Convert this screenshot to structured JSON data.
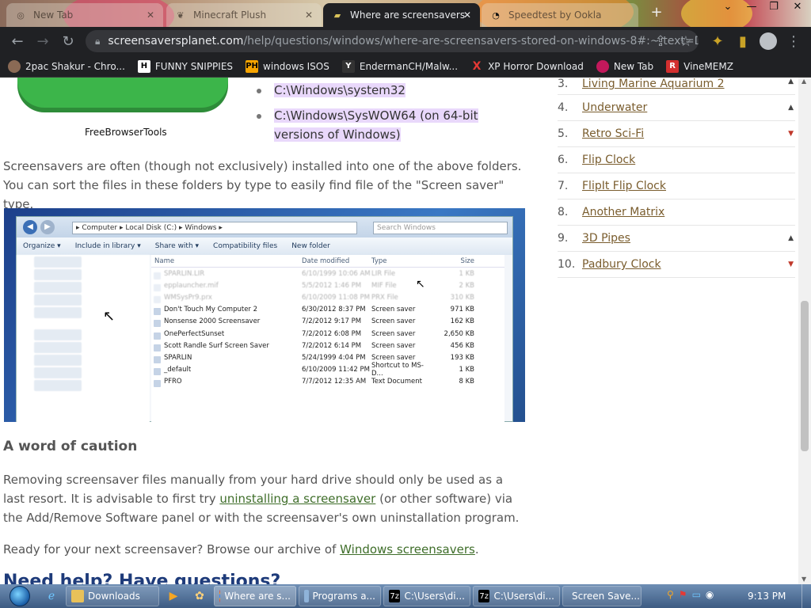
{
  "browser": {
    "tabs": [
      {
        "label": "New Tab",
        "active": false
      },
      {
        "label": "Minecraft Plush",
        "active": false
      },
      {
        "label": "Where are screensavers",
        "active": true
      },
      {
        "label": "Speedtest by Ookla",
        "active": false
      }
    ],
    "url_host": "screensaversplanet.com",
    "url_path": "/help/questions/windows/where-are-screensavers-stored-on-windows-8#:~:text=D...",
    "bookmarks": [
      {
        "label": "2pac Shakur - Chro...",
        "icon": "bookmark-2pac-icon"
      },
      {
        "label": "FUNNY SNIPPIES",
        "icon": "bookmark-h-icon"
      },
      {
        "label": "windows ISOS",
        "icon": "bookmark-ph-icon"
      },
      {
        "label": "EndermanCH/Malw...",
        "icon": "bookmark-yt-icon"
      },
      {
        "label": "XP Horror Download",
        "icon": "bookmark-x-icon"
      },
      {
        "label": "New Tab",
        "icon": "bookmark-newtab-icon"
      },
      {
        "label": "VineMEMZ",
        "icon": "bookmark-r-icon"
      }
    ]
  },
  "content": {
    "fbt_label": "FreeBrowserTools",
    "bullets": [
      "C:\\Windows\\system32",
      "C:\\Windows\\SysWOW64 (on 64-bit versions of Windows)"
    ],
    "para1": "Screensavers are often (though not exclusively) installed into one of the above folders. You can sort the files in these folders by type to easily find file of the \"Screen saver\" type.",
    "explorer": {
      "address": "▸ Computer ▸ Local Disk (C:) ▸ Windows ▸",
      "search_placeholder": "Search Windows",
      "commands": [
        "Organize ▾",
        "Include in library ▾",
        "Share with ▾",
        "Compatibility files",
        "New folder"
      ],
      "headers": [
        "Name",
        "Date modified",
        "Type",
        "Size"
      ],
      "rows": [
        {
          "name": "SPARLIN.LIR",
          "date": "6/10/1999 10:06 AM",
          "type": "LIR File",
          "size": "1 KB",
          "faded": true
        },
        {
          "name": "epplauncher.mif",
          "date": "5/5/2012 1:46 PM",
          "type": "MIF File",
          "size": "2 KB",
          "faded": true
        },
        {
          "name": "WMSysPr9.prx",
          "date": "6/10/2009 11:08 PM",
          "type": "PRX File",
          "size": "310 KB",
          "faded": true
        },
        {
          "name": "Don't Touch My Computer 2",
          "date": "6/30/2012 8:37 PM",
          "type": "Screen saver",
          "size": "971 KB",
          "faded": false
        },
        {
          "name": "Nonsense 2000 Screensaver",
          "date": "7/2/2012 9:17 PM",
          "type": "Screen saver",
          "size": "162 KB",
          "faded": false
        },
        {
          "name": "OnePerfectSunset",
          "date": "7/2/2012 6:08 PM",
          "type": "Screen saver",
          "size": "2,650 KB",
          "faded": false
        },
        {
          "name": "Scott Randle Surf Screen Saver",
          "date": "7/2/2012 6:14 PM",
          "type": "Screen saver",
          "size": "456 KB",
          "faded": false
        },
        {
          "name": "SPARLIN",
          "date": "5/24/1999 4:04 PM",
          "type": "Screen saver",
          "size": "193 KB",
          "faded": false
        },
        {
          "name": "_default",
          "date": "6/10/2009 11:42 PM",
          "type": "Shortcut to MS-D...",
          "size": "1 KB",
          "faded": false
        },
        {
          "name": "PFRO",
          "date": "7/7/2012 12:35 AM",
          "type": "Text Document",
          "size": "8 KB",
          "faded": false
        }
      ]
    },
    "caution_heading": "A word of caution",
    "para2_a": "Removing screensaver files manually from your hard drive should only be used as a last resort. It is advisable to first try ",
    "para2_link": "uninstalling a screensaver",
    "para2_b": " (or other software) via the Add/Remove Software panel or with the screensaver's own uninstallation program.",
    "para3_a": "Ready for your next screensaver? Browse our archive of ",
    "para3_link": "Windows screensavers",
    "para3_b": ".",
    "need_help": "Need help? Have questions?"
  },
  "sidebar": {
    "items": [
      {
        "num": "3.",
        "name": "Living Marine Aquarium 2",
        "trend": "up"
      },
      {
        "num": "4.",
        "name": "Underwater",
        "trend": "up"
      },
      {
        "num": "5.",
        "name": "Retro Sci-Fi",
        "trend": "down"
      },
      {
        "num": "6.",
        "name": "Flip Clock",
        "trend": "none"
      },
      {
        "num": "7.",
        "name": "FlipIt Flip Clock",
        "trend": "none"
      },
      {
        "num": "8.",
        "name": "Another Matrix",
        "trend": "none"
      },
      {
        "num": "9.",
        "name": "3D Pipes",
        "trend": "up"
      },
      {
        "num": "10.",
        "name": "Padbury Clock",
        "trend": "down"
      }
    ]
  },
  "taskbar": {
    "items": [
      {
        "label": "Downloads",
        "icon": "folder-icon"
      },
      {
        "label": "Where are s...",
        "icon": "chrome-icon"
      },
      {
        "label": "Programs a...",
        "icon": "control-panel-icon"
      },
      {
        "label": "C:\\Users\\di...",
        "icon": "7zip-icon"
      },
      {
        "label": "C:\\Users\\di...",
        "icon": "7zip-icon"
      },
      {
        "label": "Screen Save...",
        "icon": "display-icon"
      }
    ],
    "time": "9:13 PM"
  },
  "colors": {
    "highlight": "#e9d8fb",
    "link": "#3f6e2a",
    "sidebar_link": "#7a5d2e",
    "trend_down": "#c0392b"
  }
}
